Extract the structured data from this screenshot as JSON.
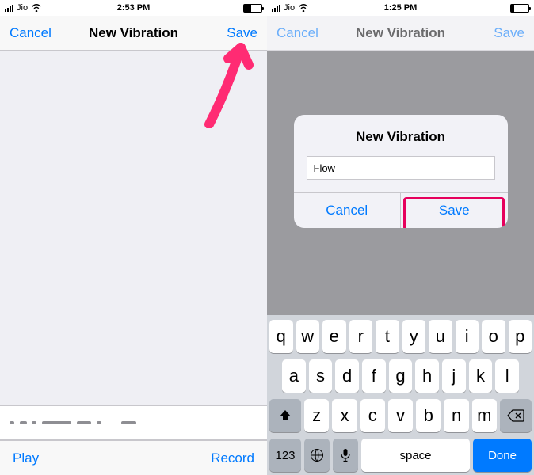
{
  "left": {
    "status": {
      "carrier": "Jio",
      "time": "2:53 PM",
      "battery_pct": 40
    },
    "nav": {
      "cancel": "Cancel",
      "title": "New Vibration",
      "save": "Save"
    },
    "toolbar": {
      "play": "Play",
      "record": "Record"
    }
  },
  "right": {
    "status": {
      "carrier": "Jio",
      "time": "1:25 PM",
      "battery_pct": 20
    },
    "nav": {
      "cancel": "Cancel",
      "title": "New Vibration",
      "save": "Save"
    },
    "alert": {
      "title": "New Vibration",
      "input_value": "Flow",
      "cancel": "Cancel",
      "save": "Save"
    },
    "keyboard": {
      "row1": [
        "q",
        "w",
        "e",
        "r",
        "t",
        "y",
        "u",
        "i",
        "o",
        "p"
      ],
      "row2": [
        "a",
        "s",
        "d",
        "f",
        "g",
        "h",
        "j",
        "k",
        "l"
      ],
      "row3": [
        "z",
        "x",
        "c",
        "v",
        "b",
        "n",
        "m"
      ],
      "num": "123",
      "space": "space",
      "done": "Done"
    }
  }
}
